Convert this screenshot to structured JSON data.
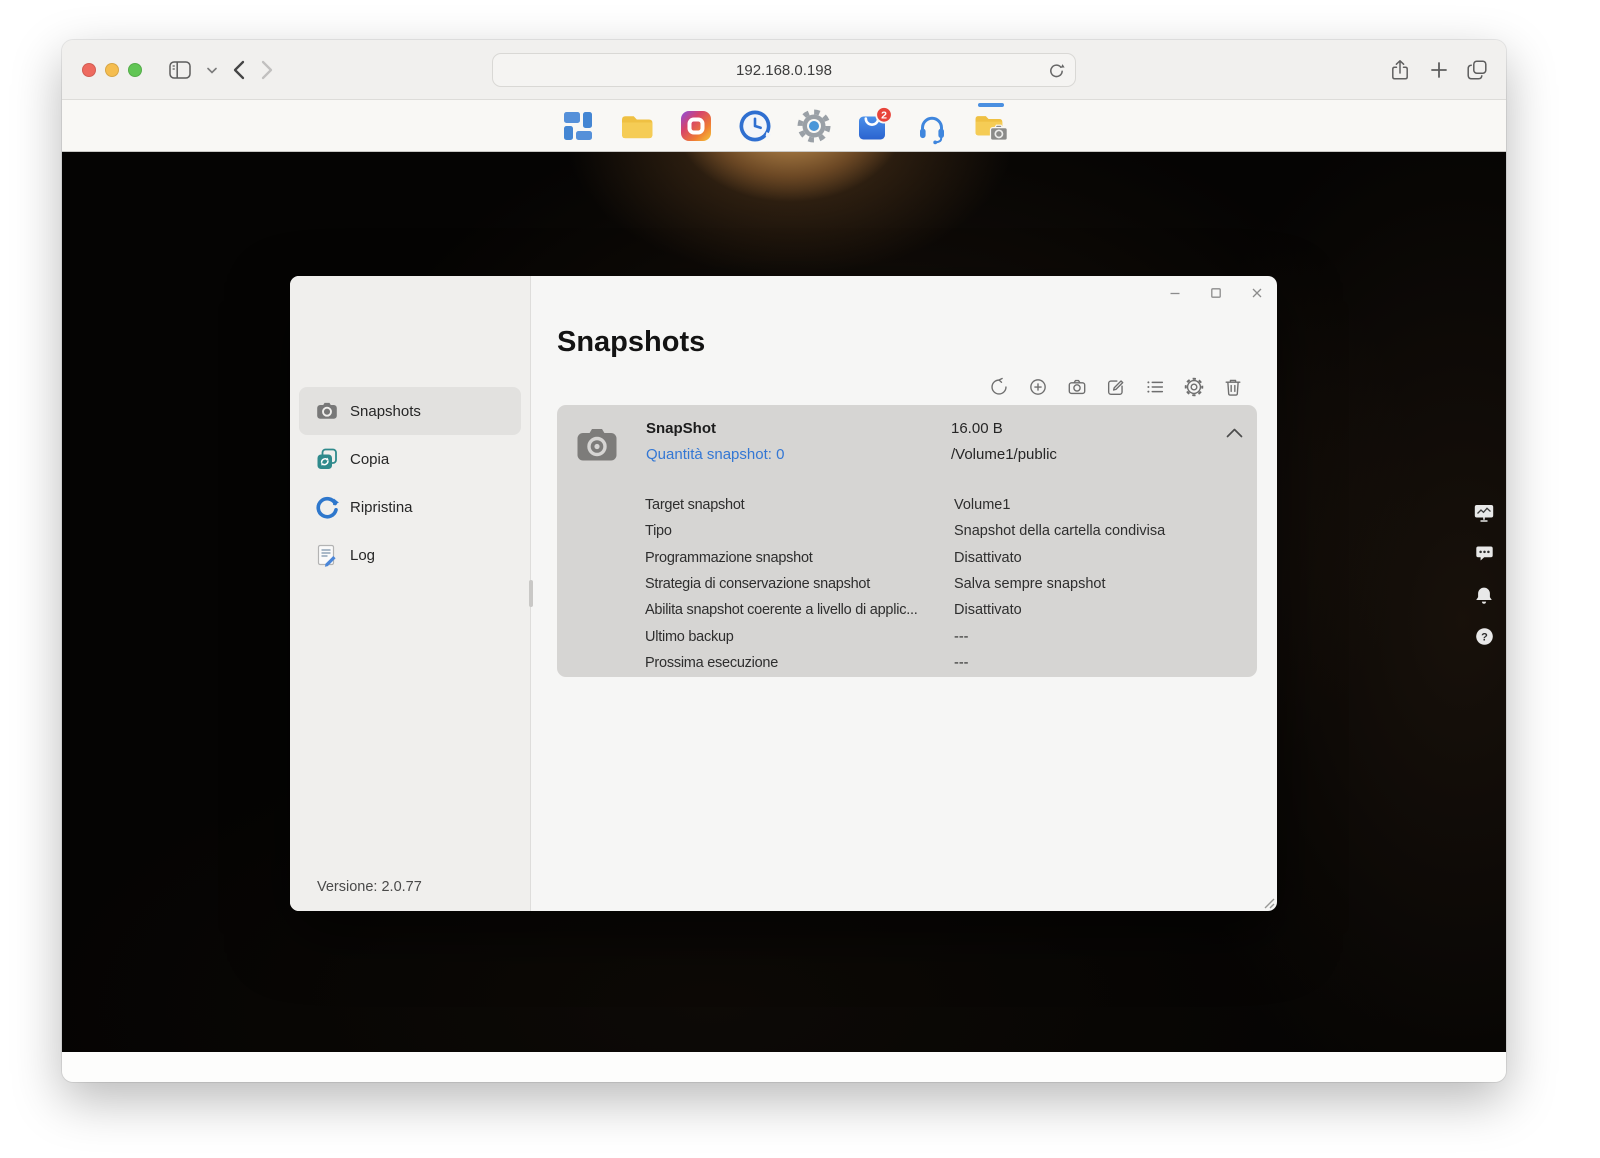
{
  "browser": {
    "url": "192.168.0.198"
  },
  "dock": {
    "badge": "2",
    "apps": [
      "control-panel",
      "file-manager",
      "multimedia",
      "backup",
      "settings",
      "app-center",
      "support",
      "snapshots"
    ],
    "active_app": "snapshots"
  },
  "app": {
    "sidebar": {
      "items": [
        {
          "label": "Snapshots"
        },
        {
          "label": "Copia"
        },
        {
          "label": "Ripristina"
        },
        {
          "label": "Log"
        }
      ],
      "version": "Versione: 2.0.77"
    },
    "main": {
      "title": "Snapshots",
      "toolbar": [
        "refresh",
        "create",
        "snapshot",
        "edit",
        "list",
        "settings",
        "delete"
      ],
      "card": {
        "name": "SnapShot",
        "quantity_link": "Quantità snapshot: 0",
        "size": "16.00 B",
        "path": "/Volume1/public",
        "details": [
          {
            "label": "Target snapshot",
            "value": "Volume1"
          },
          {
            "label": "Tipo",
            "value": "Snapshot della cartella condivisa"
          },
          {
            "label": "Programmazione snapshot",
            "value": "Disattivato"
          },
          {
            "label": "Strategia di conservazione snapshot",
            "value": "Salva sempre snapshot"
          },
          {
            "label": "Abilita snapshot coerente a livello di applic...",
            "value": "Disattivato"
          },
          {
            "label": "Ultimo backup",
            "value": "---"
          },
          {
            "label": "Prossima esecuzione",
            "value": "---"
          }
        ]
      }
    }
  },
  "edge_widgets": {
    "help_glyph": "?"
  },
  "colors": {
    "link": "#3377d4",
    "badge": "#e8443a",
    "active_indicator": "#4a8fe0"
  }
}
